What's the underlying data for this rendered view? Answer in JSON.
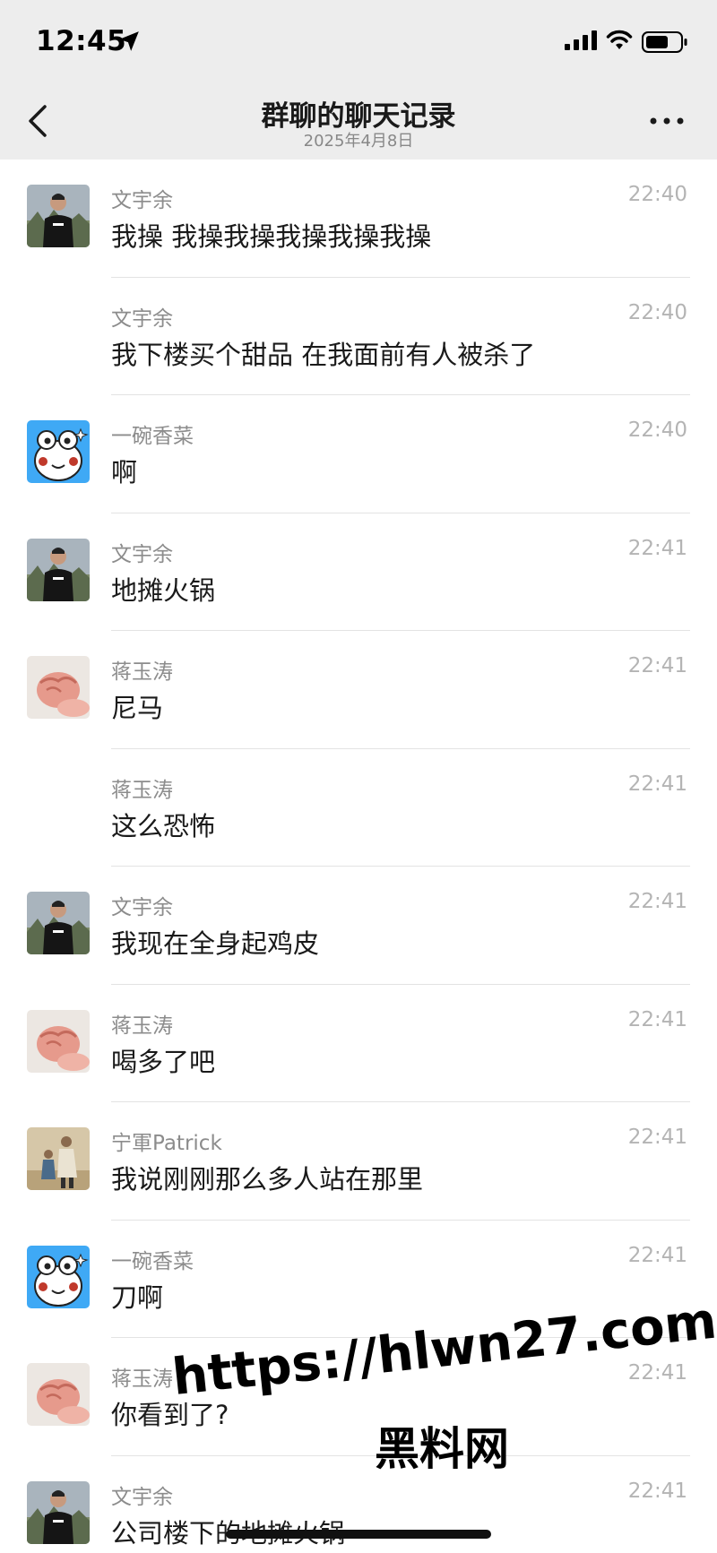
{
  "status_bar": {
    "time": "12:45"
  },
  "nav": {
    "title": "群聊的聊天记录",
    "subtitle": "2025年4月8日"
  },
  "messages": [
    {
      "sender": "文宇余",
      "text": "我操 我操我操我操我操我操",
      "time": "22:40",
      "avatar": "person-dark-shirt"
    },
    {
      "sender": "文宇余",
      "text": "我下楼买个甜品 在我面前有人被杀了",
      "time": "22:40",
      "avatar": ""
    },
    {
      "sender": "一碗香菜",
      "text": "啊",
      "time": "22:40",
      "avatar": "cartoon-frog"
    },
    {
      "sender": "文宇余",
      "text": "地摊火锅",
      "time": "22:41",
      "avatar": "person-dark-shirt"
    },
    {
      "sender": "蒋玉涛",
      "text": "尼马",
      "time": "22:41",
      "avatar": "baby-fist"
    },
    {
      "sender": "蒋玉涛",
      "text": "这么恐怖",
      "time": "22:41",
      "avatar": ""
    },
    {
      "sender": "文宇余",
      "text": "我现在全身起鸡皮",
      "time": "22:41",
      "avatar": "person-dark-shirt"
    },
    {
      "sender": "蒋玉涛",
      "text": "喝多了吧",
      "time": "22:41",
      "avatar": "baby-fist"
    },
    {
      "sender": "宁軍Patrick",
      "text": "我说刚刚那么多人站在那里",
      "time": "22:41",
      "avatar": "people-photo"
    },
    {
      "sender": "一碗香菜",
      "text": "刀啊",
      "time": "22:41",
      "avatar": "cartoon-frog"
    },
    {
      "sender": "蒋玉涛",
      "text": "你看到了?",
      "time": "22:41",
      "avatar": "baby-fist"
    },
    {
      "sender": "文宇余",
      "text": "公司楼下的地摊火锅",
      "time": "22:41",
      "avatar": "person-dark-shirt"
    }
  ],
  "watermark": {
    "url": "https://hlwn27.com",
    "label": "黑料网"
  },
  "colors": {
    "header_bg": "#ededed",
    "sender": "#8c8c8c",
    "time": "#b4b4b4",
    "divider": "#e3e3e3"
  }
}
